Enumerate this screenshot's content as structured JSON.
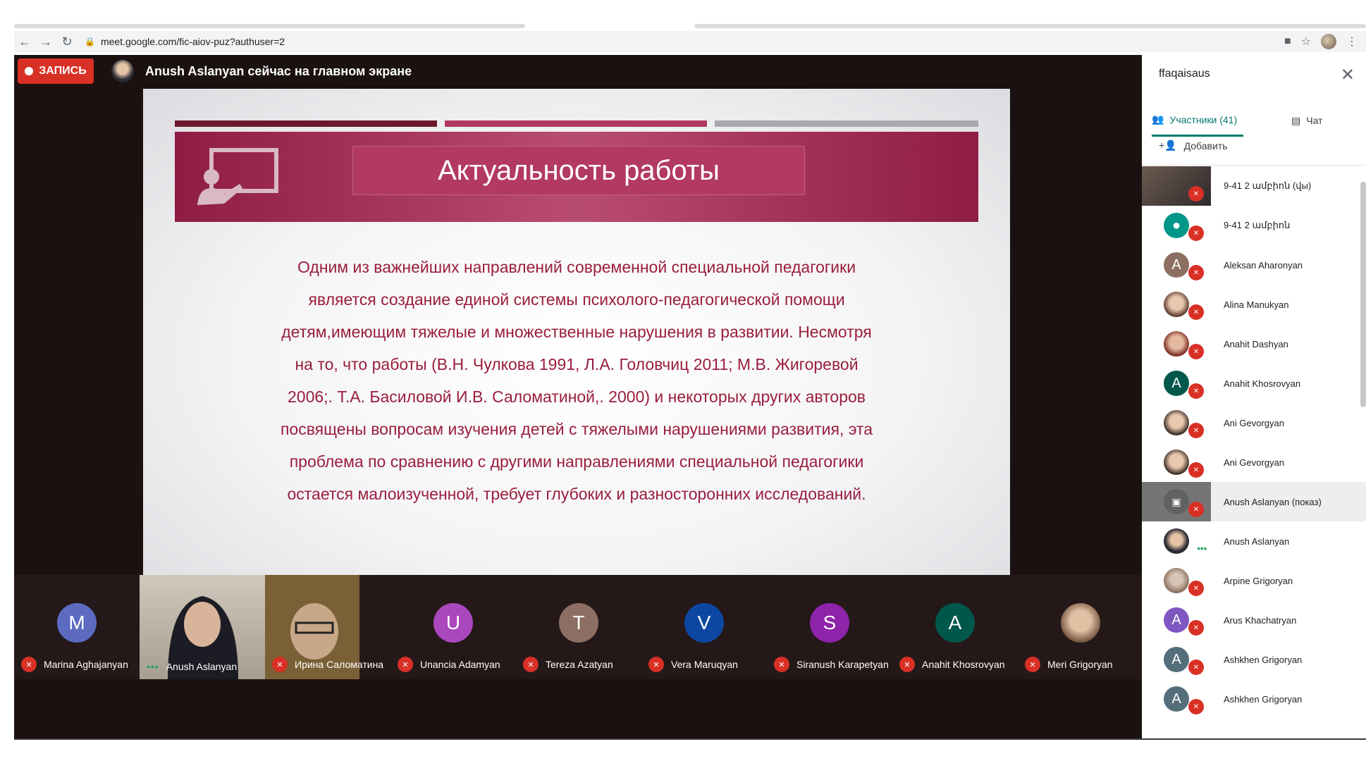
{
  "browser": {
    "url": "meet.google.com/fic-aiov-puz?authuser=2"
  },
  "meet": {
    "record_label": "ЗАПИСЬ",
    "presenter_text": "Anush Aslanyan сейчас на главном экране"
  },
  "slide": {
    "title": "Актуальность работы",
    "lines": [
      "Одним из важнейших направлений современной специальной педагогики",
      "является создание единой системы психолого-педагогической помощи",
      "детям,имеющим тяжелые и множественные нарушения в развитии. Несмотря",
      "на то, что работы (В.Н. Чулкова 1991, Л.А. Головчиц 2011; М.В. Жигоревой",
      "2006;. Т.А. Басиловой И.В. Саломатиной,. 2000) и некоторых других авторов",
      "посвящены вопросам изучения детей с тяжелыми нарушениями развития, эта",
      "проблема по сравнению с другими направлениями специальной педагогики",
      "остается малоизученной, требует глубоких и разносторонних исследований."
    ],
    "colors": {
      "banner": "#8f1c44",
      "text": "#9a1e3c"
    }
  },
  "strip": {
    "tiles": [
      {
        "initial": "M",
        "name": "Marina Aghajanyan",
        "color": "#5c6bc0",
        "status": "muted"
      },
      {
        "initial": "",
        "name": "Anush Aslanyan",
        "color": "",
        "status": "speaking"
      },
      {
        "initial": "",
        "name": "Ирина Саломатина",
        "color": "",
        "status": "muted"
      },
      {
        "initial": "U",
        "name": "Unancia Adamyan",
        "color": "#ab47bc",
        "status": "muted"
      },
      {
        "initial": "T",
        "name": "Tereza Azatyan",
        "color": "#8d6e63",
        "status": "muted"
      },
      {
        "initial": "V",
        "name": "Vera Maruqyan",
        "color": "#0d47a1",
        "status": "muted"
      },
      {
        "initial": "S",
        "name": "Siranush Karapetyan",
        "color": "#8e24aa",
        "status": "muted"
      },
      {
        "initial": "A",
        "name": "Anahit Khosrovyan",
        "color": "#00574b",
        "status": "muted"
      },
      {
        "initial": "",
        "name": "Meri Grigoryan",
        "color": "",
        "status": "muted"
      }
    ]
  },
  "sidebar": {
    "header": "ffaqaisaus",
    "tab_participants": "Участники (41)",
    "tab_chat": "Чат",
    "add_label": "Добавить",
    "participants": [
      {
        "name": "9-41 2 ամբիոն (վы)",
        "initial": "",
        "color": "",
        "status": "muted"
      },
      {
        "name": "9-41 2 ամբիոն",
        "initial": "",
        "color": "#009688",
        "status": "muted"
      },
      {
        "name": "Aleksan Aharonyan",
        "initial": "A",
        "color": "#8d6e63",
        "status": "muted"
      },
      {
        "name": "Alina Manukyan",
        "initial": "",
        "color": "",
        "status": "muted"
      },
      {
        "name": "Anahit Dashyan",
        "initial": "",
        "color": "",
        "status": "muted"
      },
      {
        "name": "Anahit Khosrovyan",
        "initial": "A",
        "color": "#00574b",
        "status": "muted"
      },
      {
        "name": "Ani Gevorgyan",
        "initial": "",
        "color": "",
        "status": "muted"
      },
      {
        "name": "Ani Gevorgyan",
        "initial": "",
        "color": "",
        "status": "muted"
      },
      {
        "name": "Anush Aslanyan (показ)",
        "initial": "",
        "color": "#616161",
        "status": "muted"
      },
      {
        "name": "Anush Aslanyan",
        "initial": "",
        "color": "",
        "status": "speaking"
      },
      {
        "name": "Arpine Grigoryan",
        "initial": "",
        "color": "",
        "status": "muted"
      },
      {
        "name": "Arus Khachatryan",
        "initial": "A",
        "color": "#7e57c2",
        "status": "muted"
      },
      {
        "name": "Ashkhen Grigoryan",
        "initial": "A",
        "color": "#546e7a",
        "status": "muted"
      },
      {
        "name": "Ashkhen Grigoryan",
        "initial": "A",
        "color": "#546e7a",
        "status": "muted"
      }
    ]
  }
}
